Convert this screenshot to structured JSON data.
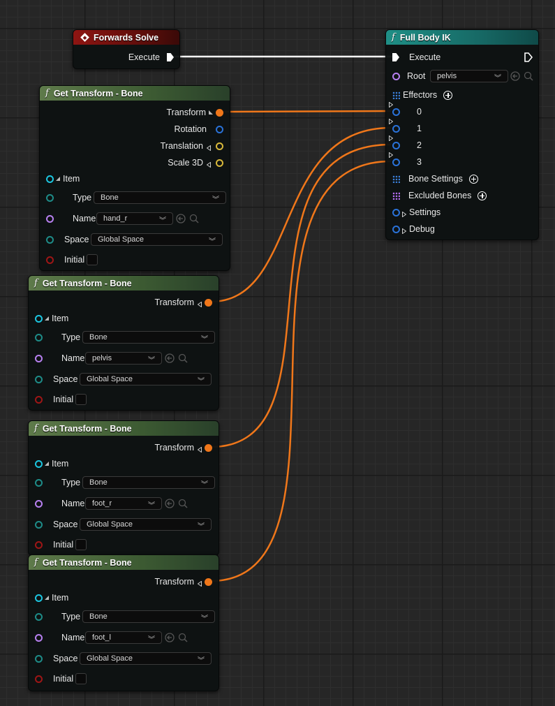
{
  "forwards_solve": {
    "title": "Forwards Solve",
    "execute": "Execute"
  },
  "full_body_ik": {
    "title": "Full Body IK",
    "execute": "Execute",
    "root_label": "Root",
    "root_value": "pelvis",
    "effectors_label": "Effectors",
    "effectors": [
      "0",
      "1",
      "2",
      "3"
    ],
    "bone_settings": "Bone Settings",
    "excluded_bones": "Excluded Bones",
    "settings": "Settings",
    "debug": "Debug"
  },
  "get_transform_1": {
    "title": "Get Transform - Bone",
    "outputs": {
      "transform": "Transform",
      "rotation": "Rotation",
      "translation": "Translation",
      "scale": "Scale 3D"
    },
    "item": "Item",
    "type_label": "Type",
    "type_value": "Bone",
    "name_label": "Name",
    "name_value": "hand_r",
    "space_label": "Space",
    "space_value": "Global Space",
    "initial_label": "Initial"
  },
  "get_transform_2": {
    "title": "Get Transform - Bone",
    "transform": "Transform",
    "item": "Item",
    "type_label": "Type",
    "type_value": "Bone",
    "name_label": "Name",
    "name_value": "pelvis",
    "space_label": "Space",
    "space_value": "Global Space",
    "initial_label": "Initial"
  },
  "get_transform_3": {
    "title": "Get Transform - Bone",
    "transform": "Transform",
    "item": "Item",
    "type_label": "Type",
    "type_value": "Bone",
    "name_label": "Name",
    "name_value": "foot_r",
    "space_label": "Space",
    "space_value": "Global Space",
    "initial_label": "Initial"
  },
  "get_transform_4": {
    "title": "Get Transform - Bone",
    "transform": "Transform",
    "item": "Item",
    "type_label": "Type",
    "type_value": "Bone",
    "name_label": "Name",
    "name_value": "foot_l",
    "space_label": "Space",
    "space_value": "Global Space",
    "initial_label": "Initial"
  },
  "colors": {
    "exec_wire": "#ffffff",
    "transform_wire": "#f0771a",
    "canvas": "#262626"
  }
}
